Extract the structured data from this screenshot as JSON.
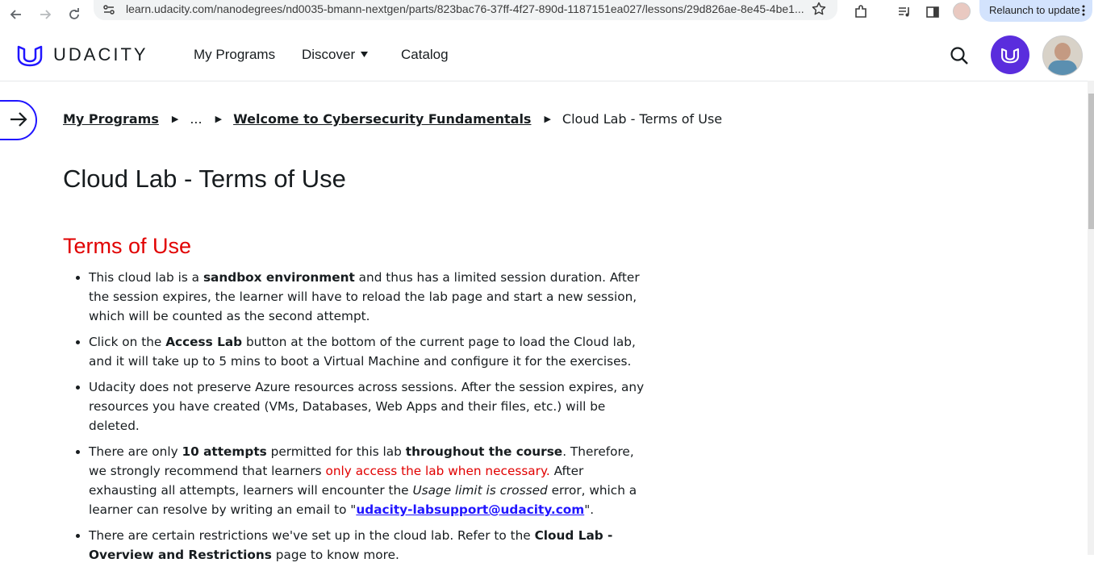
{
  "browser": {
    "url": "learn.udacity.com/nanodegrees/nd0035-bmann-nextgen/parts/823bac76-37ff-4f27-890d-1187151ea027/lessons/29d826ae-8e45-4be1...",
    "relaunch_label": "Relaunch to update"
  },
  "header": {
    "logo_text": "UDACITY",
    "nav": [
      "My Programs",
      "Discover",
      "Catalog"
    ]
  },
  "breadcrumb": {
    "root": "My Programs",
    "ellipsis": "...",
    "parent": "Welcome to Cybersecurity Fundamentals",
    "current": "Cloud Lab - Terms of Use"
  },
  "page": {
    "title": "Cloud Lab - Terms of Use",
    "section_title": "Terms of Use"
  },
  "terms": {
    "item1": {
      "a": "This cloud lab is a ",
      "b": "sandbox environment",
      "c": " and thus has a limited session duration. After the session expires, the learner will have to reload the lab page and start a new session, which will be counted as the second attempt."
    },
    "item2": {
      "a": "Click on the ",
      "b": "Access Lab",
      "c": " button at the bottom of the current page to load the Cloud lab, and it will take up to 5 mins to boot a Virtual Machine and configure it for the exercises."
    },
    "item3": {
      "a": "Udacity does not preserve Azure resources across sessions. After the session expires, any resources you have created (VMs, Databases, Web Apps and their files, etc.) will be deleted."
    },
    "item4": {
      "a": "There are only ",
      "b": "10 attempts",
      "c": " permitted for this lab ",
      "d": "throughout the course",
      "e": ". Therefore, we strongly recommend that learners ",
      "f": "only access the lab when necessary.",
      "g": " After exhausting all attempts, learners will encounter the ",
      "h": "Usage limit is crossed",
      "i": " error, which a learner can resolve by writing an email to \"",
      "j": "udacity-labsupport@udacity.com",
      "k": "\"."
    },
    "item5": {
      "a": "There are certain restrictions we've set up in the cloud lab. Refer to the ",
      "b": "Cloud Lab - Overview and Restrictions",
      "c": " page to know more."
    }
  },
  "colors": {
    "accent": "#2015ff",
    "heading_red": "#e10000",
    "text": "#171c1f"
  }
}
